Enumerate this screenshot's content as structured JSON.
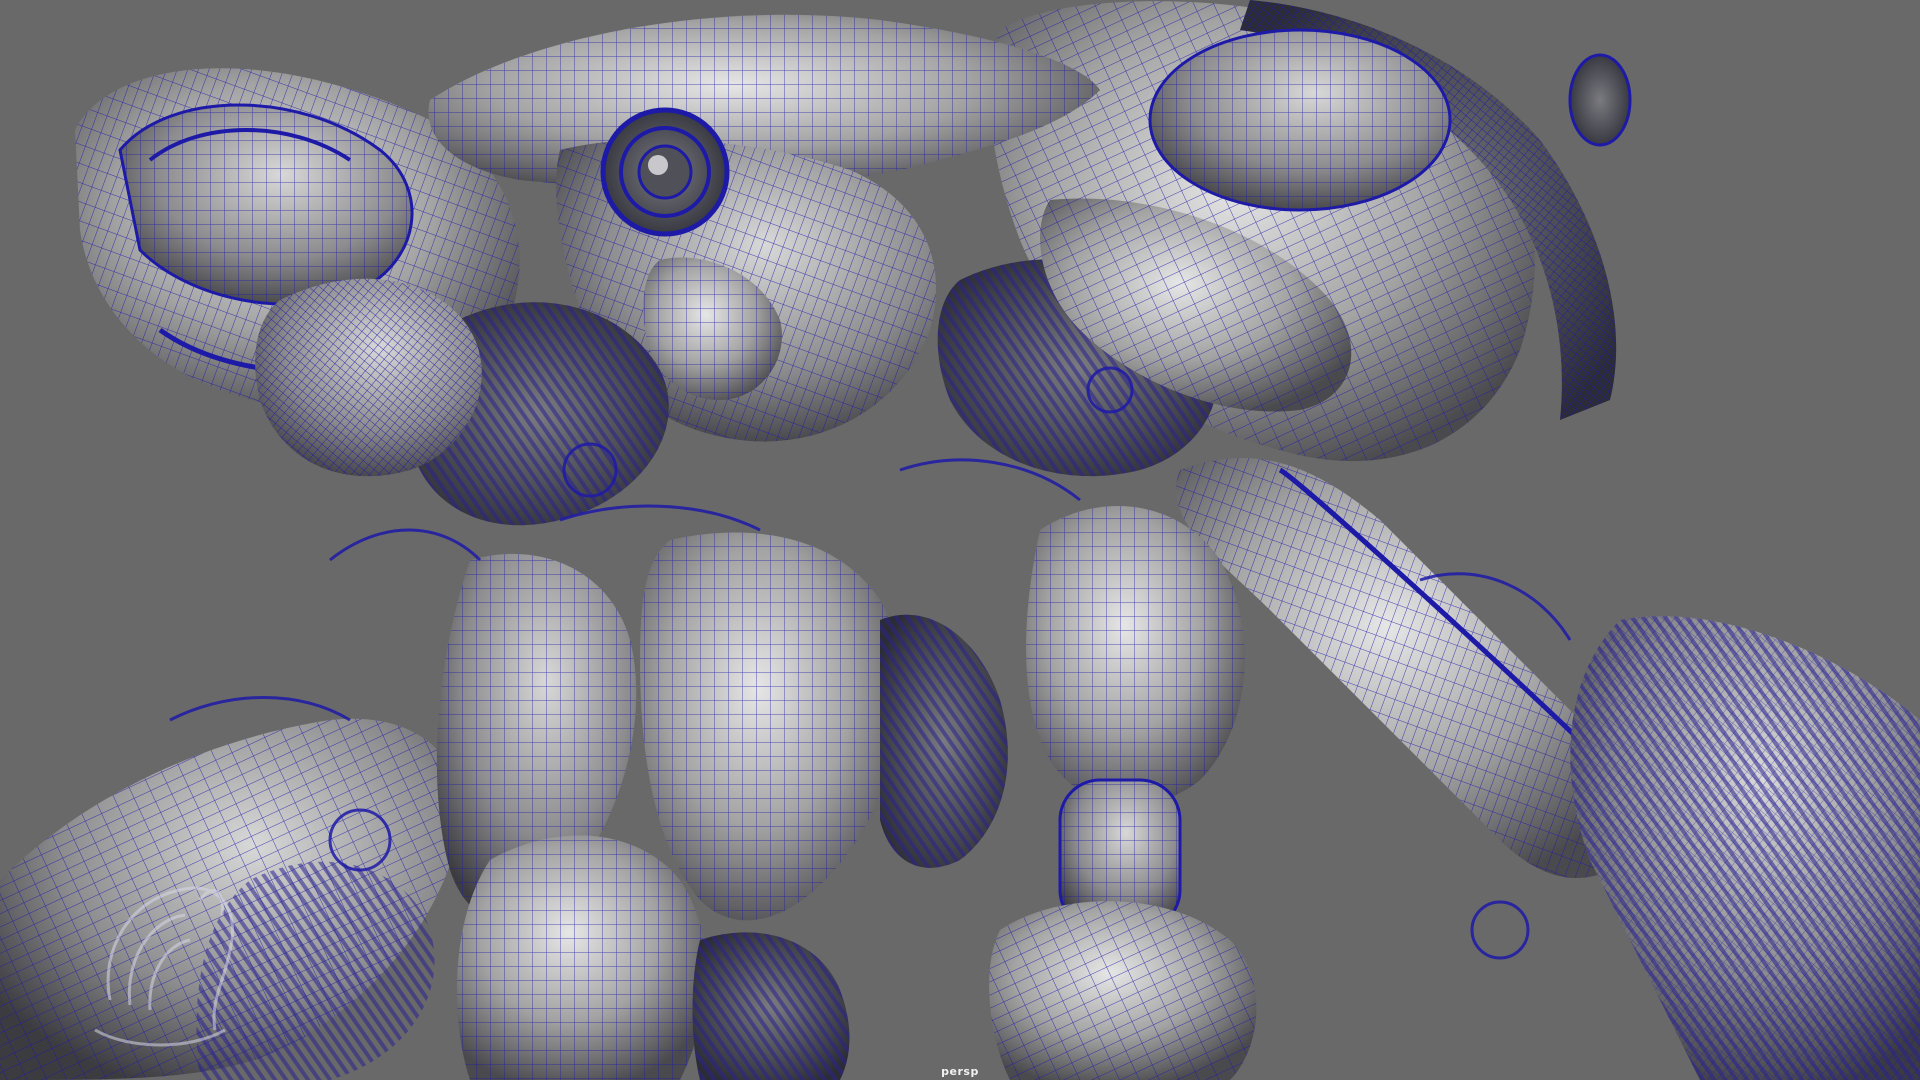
{
  "viewport": {
    "camera_name": "persp",
    "background_color": "#696969",
    "wireframe_color": "#1e1aa8",
    "shaded_color": "#9a9a9a",
    "display_mode": "wireframe-on-shaded",
    "subject": "mech-robot-model"
  },
  "watermark": {
    "logo_icon": "face-swirl-logo-icon"
  }
}
